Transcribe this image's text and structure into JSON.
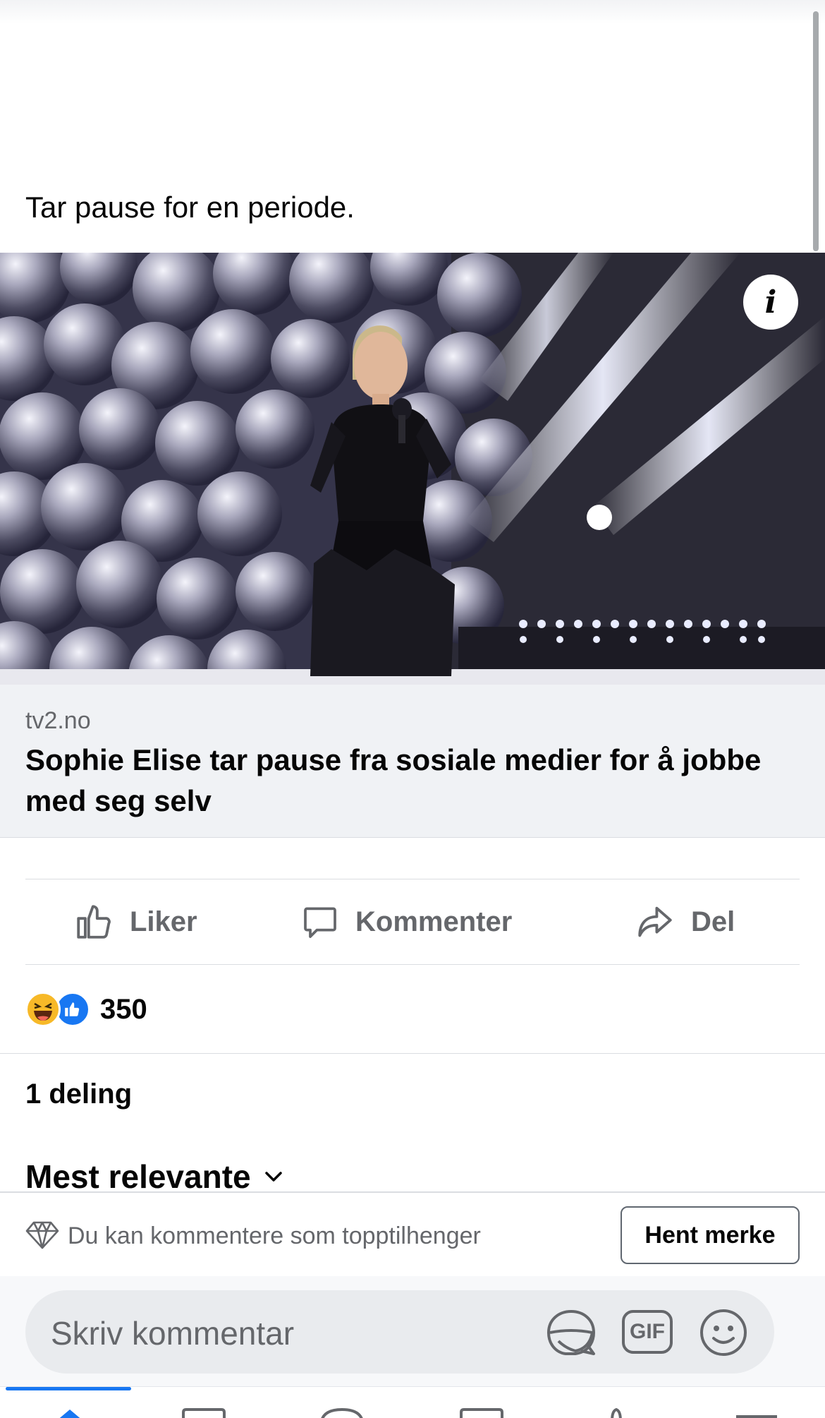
{
  "post": {
    "text": "Tar pause for en periode.",
    "info_label": "i"
  },
  "link_preview": {
    "domain": "tv2.no",
    "title": "Sophie Elise tar pause fra sosiale medier for å jobbe med seg selv"
  },
  "actions": {
    "like_label": "Liker",
    "comment_label": "Kommenter",
    "share_label": "Del"
  },
  "reactions": {
    "count": "350",
    "types": [
      "haha-icon",
      "like-icon"
    ]
  },
  "shares": {
    "label": "1 deling"
  },
  "comments": {
    "sort_label": "Mest relevante"
  },
  "top_fan": {
    "message": "Du kan kommentere som topptilhenger",
    "button_label": "Hent merke"
  },
  "composer": {
    "placeholder": "Skriv kommentar",
    "gif_label": "GIF"
  },
  "colors": {
    "accent": "#1877f2",
    "secondary_text": "#65676b",
    "preview_bg": "#f0f2f5"
  }
}
